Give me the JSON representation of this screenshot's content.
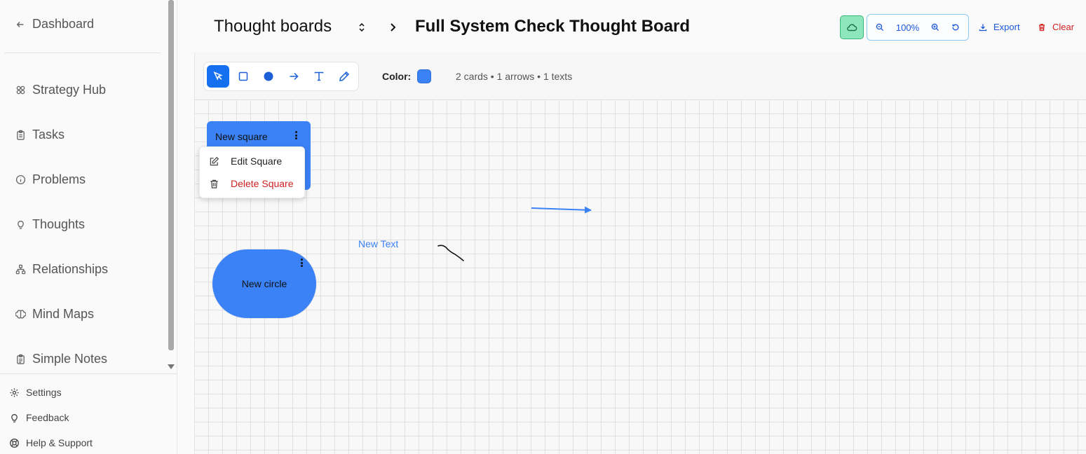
{
  "sidebar": {
    "back_label": "Dashboard",
    "items": [
      {
        "label": "Strategy Hub",
        "icon": "strategy-hub-icon"
      },
      {
        "label": "Tasks",
        "icon": "clipboard-icon"
      },
      {
        "label": "Problems",
        "icon": "info-circle-icon"
      },
      {
        "label": "Thoughts",
        "icon": "lightbulb-icon"
      },
      {
        "label": "Relationships",
        "icon": "network-icon"
      },
      {
        "label": "Mind Maps",
        "icon": "brain-icon"
      },
      {
        "label": "Simple Notes",
        "icon": "notes-icon"
      }
    ],
    "footer": [
      {
        "label": "Settings",
        "icon": "gear-icon"
      },
      {
        "label": "Feedback",
        "icon": "lightbulb-icon"
      },
      {
        "label": "Help & Support",
        "icon": "lifebuoy-icon"
      }
    ]
  },
  "header": {
    "breadcrumb_parent": "Thought boards",
    "board_title": "Full System Check Thought Board",
    "zoom": "100%",
    "export_label": "Export",
    "clear_label": "Clear"
  },
  "toolbar": {
    "tools": [
      "select",
      "rectangle",
      "circle",
      "arrow",
      "text",
      "pen"
    ],
    "active_tool": "select",
    "color_label": "Color:",
    "color": "#3b82f6",
    "stats": "2 cards • 1 arrows • 1 texts"
  },
  "canvas": {
    "square_card": {
      "label": "New square"
    },
    "context_menu": {
      "edit_label": "Edit Square",
      "delete_label": "Delete Square"
    },
    "circle_card": {
      "label": "New circle"
    },
    "text_item": "New Text"
  },
  "colors": {
    "accent": "#3b82f6",
    "primary_blue": "#1570ef",
    "danger": "#d21f1f",
    "sync_green": "#8ee6bb"
  }
}
